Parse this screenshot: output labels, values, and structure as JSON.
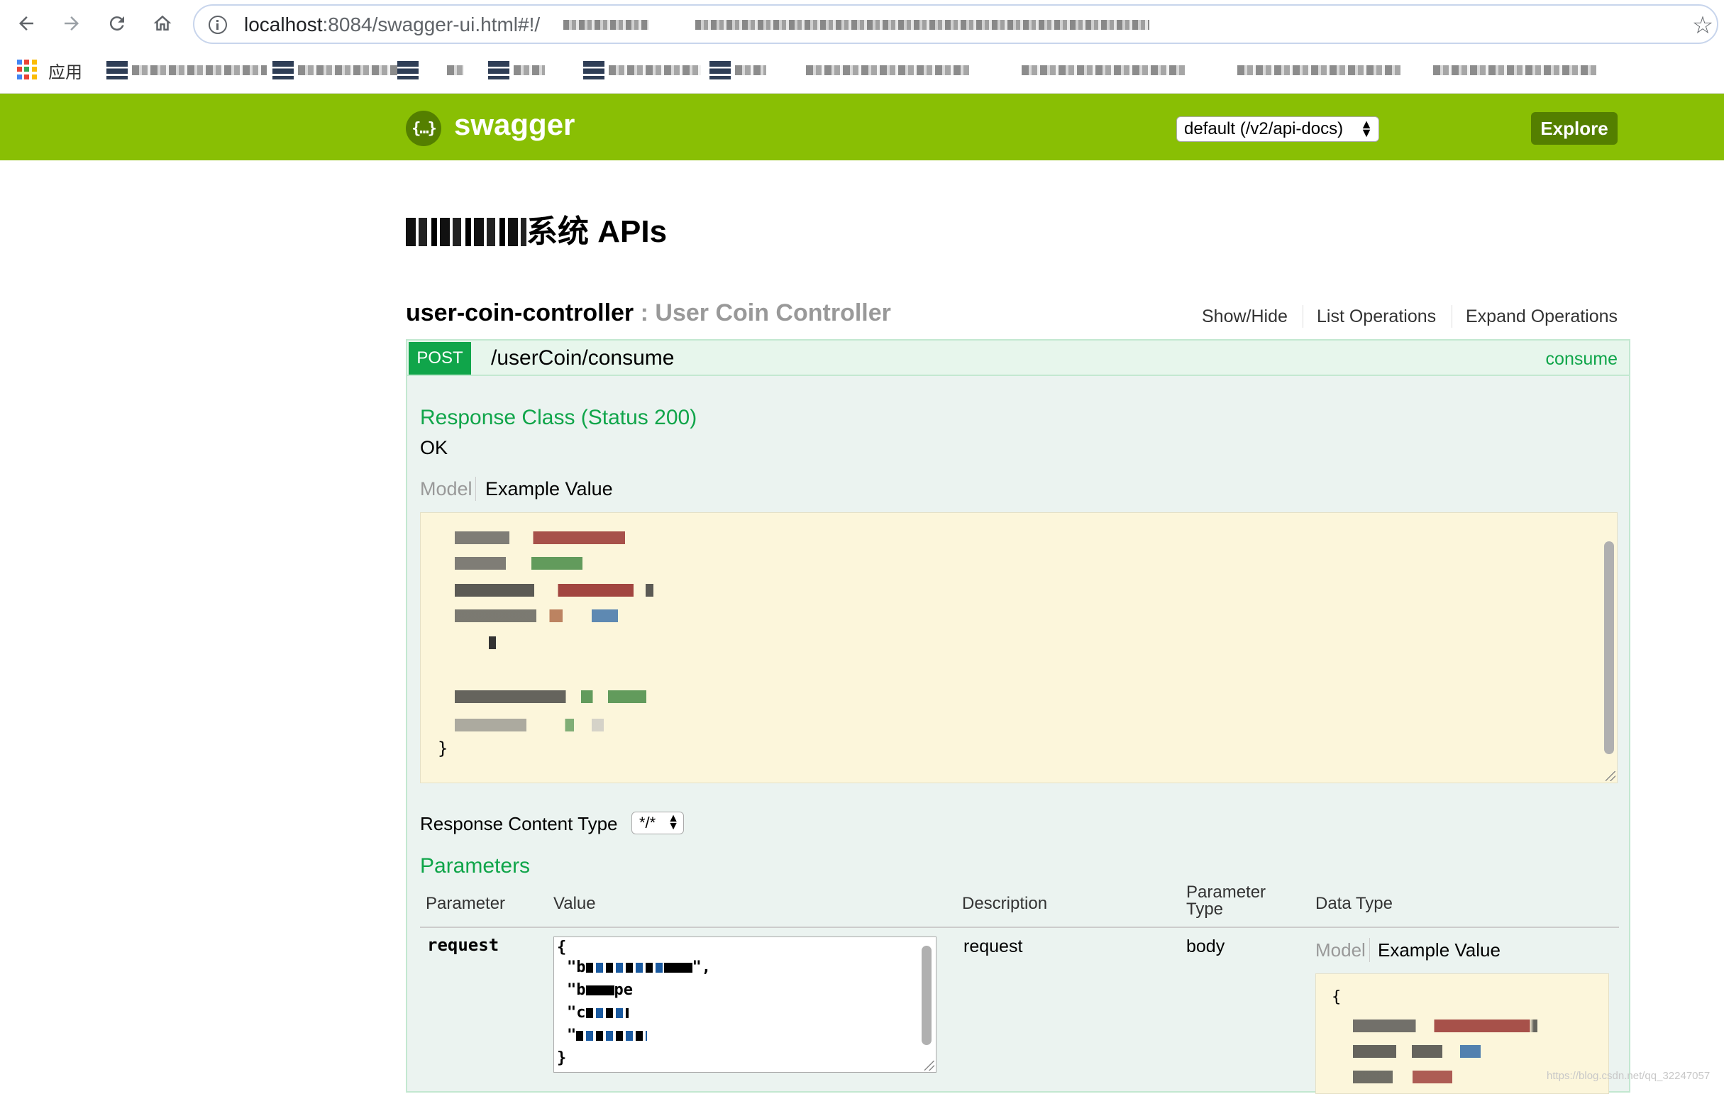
{
  "browser": {
    "url_host": "localhost",
    "url_rest": ":8084/swagger-ui.html#!/",
    "bookmarks_apps_label": "应用"
  },
  "header": {
    "logo_glyph": "{…}",
    "logo_text": "swagger",
    "spec_select_value": "default (/v2/api-docs)",
    "explore_label": "Explore"
  },
  "page": {
    "title_suffix": "系统 APIs"
  },
  "controller": {
    "name": "user-coin-controller",
    "separator": " : ",
    "description": "User Coin Controller",
    "links": [
      "Show/Hide",
      "List Operations",
      "Expand Operations"
    ]
  },
  "operation": {
    "method": "POST",
    "path": "/userCoin/consume",
    "summary": "consume",
    "response_class_title": "Response Class (Status 200)",
    "response_class_value": "OK",
    "model_tab": "Model",
    "example_tab": "Example Value",
    "example_closing_brace": "}",
    "response_content_type_label": "Response Content Type",
    "response_content_type_value": "*/*",
    "parameters_title": "Parameters",
    "table_headers": {
      "parameter": "Parameter",
      "value": "Value",
      "description": "Description",
      "parameter_type_line1": "Parameter",
      "parameter_type_line2": "Type",
      "data_type": "Data Type"
    },
    "parameter_row": {
      "name": "request",
      "value_open_brace": "{",
      "value_line1_prefix": "\"b",
      "value_line1_suffix": "\",",
      "value_line2_prefix": "\"b",
      "value_line2_mid": "pe",
      "value_line3_prefix": "\"c",
      "value_line4_prefix": "\"",
      "value_close_brace": "}",
      "description": "request",
      "parameter_type": "body",
      "data_type_model_tab": "Model",
      "data_type_example_tab": "Example Value",
      "data_type_open_brace": "{"
    }
  },
  "watermark": "https://blog.csdn.net/qq_32247057",
  "colors": {
    "swagger_green": "#89bf04",
    "swagger_dark_green": "#547f00",
    "post_green": "#10a54a",
    "op_background": "#ebf3f0",
    "code_background": "#fcf6db"
  }
}
